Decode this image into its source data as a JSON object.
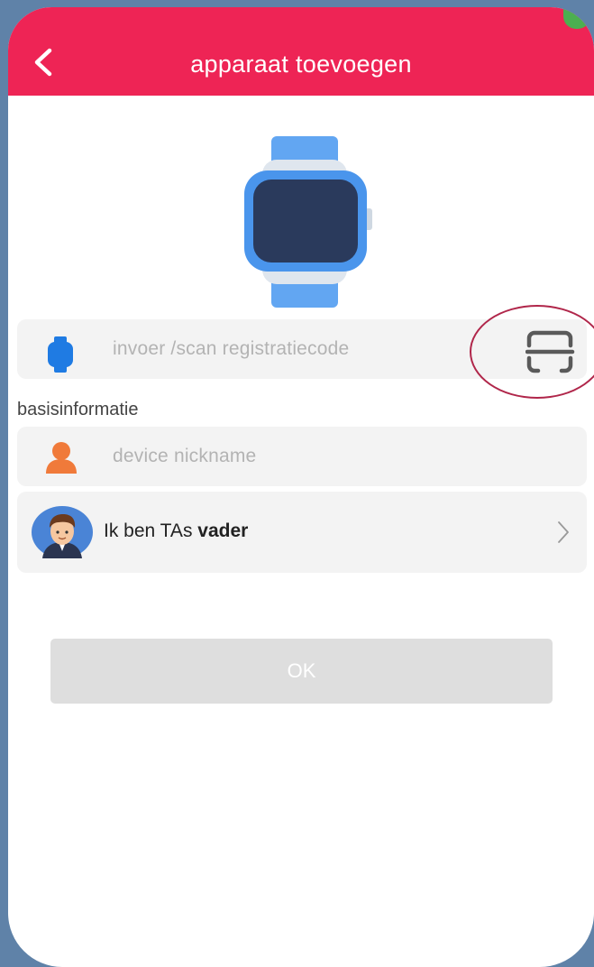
{
  "header": {
    "title": "apparaat toevoegen",
    "back_icon": "chevron-left-icon",
    "background_color": "#ee2455"
  },
  "registration": {
    "placeholder": "invoer /scan registratiecode",
    "leading_icon": "watch-icon",
    "action_icon": "scan-qr-icon"
  },
  "basic_info": {
    "section_label": "basisinformatie",
    "nickname_placeholder": "device nickname",
    "nickname_icon": "person-icon",
    "role": {
      "prefix": "Ik ben TAs ",
      "value": "vader",
      "avatar": "father-avatar",
      "trailing_icon": "chevron-right-icon"
    }
  },
  "ok_button": {
    "label": "OK"
  },
  "colors": {
    "accent": "#ee2455",
    "watch_blue": "#4a95ec",
    "person_orange": "#f07a3a",
    "annotation": "#b0264a"
  }
}
